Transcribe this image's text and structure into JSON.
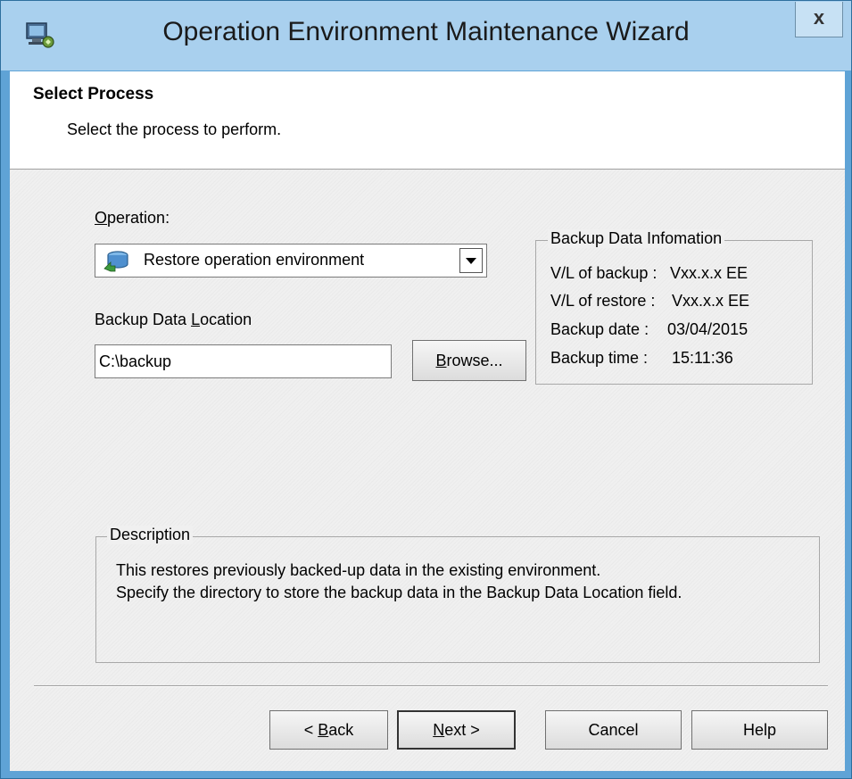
{
  "window": {
    "title": "Operation Environment Maintenance Wizard",
    "close_label": "x",
    "icon": "wizard-app-icon"
  },
  "header": {
    "title": "Select Process",
    "subtitle": "Select the process to perform."
  },
  "operation": {
    "label_prefix": "",
    "label_mnemonic": "O",
    "label_rest": "peration:",
    "selected": "Restore operation environment",
    "icon": "restore-environment-icon"
  },
  "backup_location": {
    "label_prefix": "Backup Data ",
    "label_mnemonic": "L",
    "label_rest": "ocation",
    "value": "C:\\backup",
    "browse_prefix": "",
    "browse_mnemonic": "B",
    "browse_rest": "rowse..."
  },
  "backup_info": {
    "title": "Backup Data Infomation",
    "rows": [
      {
        "label": "V/L of backup :",
        "value": "Vxx.x.x EE"
      },
      {
        "label": "V/L of restore :",
        "value": "Vxx.x.x EE"
      },
      {
        "label": "Backup date :",
        "value": "03/04/2015"
      },
      {
        "label": "Backup time :",
        "value": "15:11:36"
      }
    ]
  },
  "description": {
    "title": "Description",
    "lines": [
      "This restores previously backed-up data in the existing environment.",
      "Specify the directory to store the backup data in the Backup Data Location field."
    ]
  },
  "buttons": {
    "back_prefix": "< ",
    "back_mnemonic": "B",
    "back_rest": "ack",
    "next_prefix": "",
    "next_mnemonic": "N",
    "next_rest": "ext >",
    "cancel": "Cancel",
    "help": "Help"
  }
}
